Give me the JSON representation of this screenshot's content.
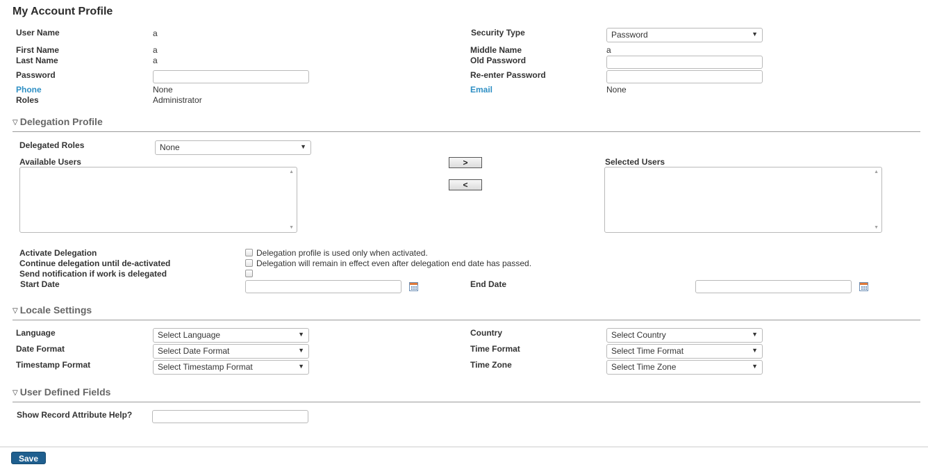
{
  "page_title": "My Account Profile",
  "account": {
    "user_name_label": "User Name",
    "user_name_value": "a",
    "security_type_label": "Security Type",
    "security_type_value": "Password",
    "first_name_label": "First Name",
    "first_name_value": "a",
    "middle_name_label": "Middle Name",
    "middle_name_value": "a",
    "last_name_label": "Last Name",
    "last_name_value": "a",
    "old_password_label": "Old Password",
    "password_label": "Password",
    "reenter_password_label": "Re-enter Password",
    "phone_label": "Phone",
    "phone_value": "None",
    "email_label": "Email",
    "email_value": "None",
    "roles_label": "Roles",
    "roles_value": "Administrator"
  },
  "delegation": {
    "section_title": "Delegation Profile",
    "delegated_roles_label": "Delegated Roles",
    "delegated_roles_value": "None",
    "available_users_label": "Available Users",
    "selected_users_label": "Selected Users",
    "move_right_label": ">",
    "move_left_label": "<",
    "activate_label": "Activate Delegation",
    "activate_desc": "Delegation profile is used only when activated.",
    "continue_label": "Continue delegation until de-activated",
    "continue_desc": "Delegation will remain in effect even after delegation end date has passed.",
    "notify_label": "Send notification if work is delegated",
    "start_date_label": "Start Date",
    "end_date_label": "End Date"
  },
  "locale": {
    "section_title": "Locale Settings",
    "language_label": "Language",
    "language_value": "Select Language",
    "country_label": "Country",
    "country_value": "Select Country",
    "date_format_label": "Date Format",
    "date_format_value": "Select Date Format",
    "time_format_label": "Time Format",
    "time_format_value": "Select Time Format",
    "timestamp_format_label": "Timestamp Format",
    "timestamp_format_value": "Select Timestamp Format",
    "time_zone_label": "Time Zone",
    "time_zone_value": "Select Time Zone"
  },
  "udf": {
    "section_title": "User Defined Fields",
    "show_help_label": "Show Record Attribute Help?"
  },
  "footer": {
    "save_label": "Save"
  },
  "colors": {
    "link": "#2e8fc4",
    "save_button": "#1f5f8f",
    "section_title": "#666666"
  },
  "icons": {
    "section_toggle": "triangle-down-icon",
    "dropdown": "chevron-down-icon",
    "date_picker": "calendar-icon"
  }
}
